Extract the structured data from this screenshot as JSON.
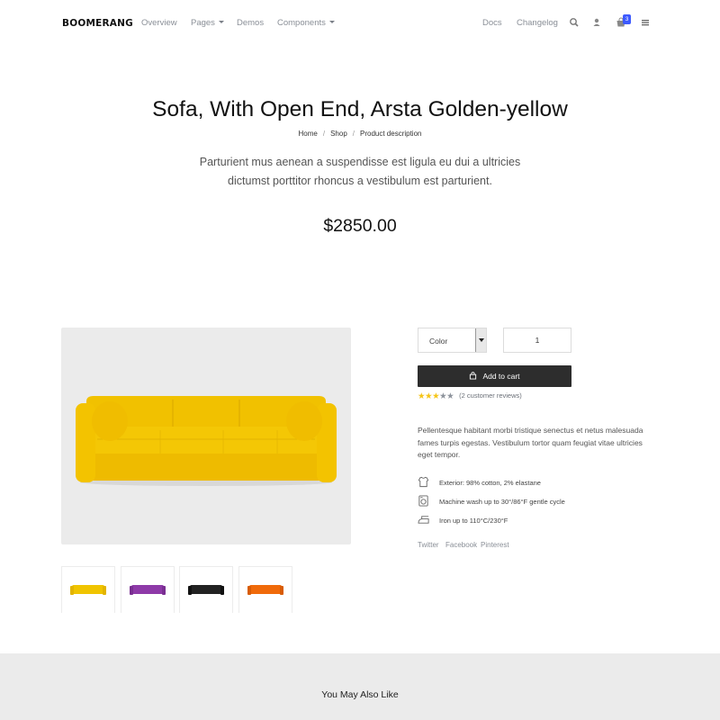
{
  "nav": {
    "brand": "BOOMERANG",
    "items": [
      {
        "label": "Overview"
      },
      {
        "label": "Pages"
      },
      {
        "label": "Demos"
      },
      {
        "label": "Components"
      }
    ],
    "right_items": [
      {
        "label": "Docs"
      },
      {
        "label": "Changelog"
      }
    ],
    "icons": [
      "search-icon",
      "user-icon",
      "cart-icon",
      "menu-icon"
    ],
    "cart_count": "3"
  },
  "hero": {
    "title": "Sofa, With Open End, Arsta Golden-yellow",
    "breadcrumb": [
      "Home",
      "Shop",
      "Product description"
    ],
    "subtitle": "Parturient mus aenean a suspendisse est ligula eu dui a ultricies dictumst porttitor rhoncus a vestibulum est parturient.",
    "price": "$2850.00"
  },
  "gallery": {
    "thumbnails": [
      {
        "color": "#f0c400"
      },
      {
        "color": "#8e3aa8"
      },
      {
        "color": "#222222"
      },
      {
        "color": "#f06a0a"
      }
    ]
  },
  "product": {
    "color_label": "Color",
    "quantity": "1",
    "add_to_cart": "Add to cart",
    "rating": 3,
    "rating_max": 5,
    "reviews": "(2 customer reviews)",
    "description": "Pellentesque habitant morbi tristique senectus et netus malesuada fames turpis egestas. Vestibulum tortor quam feugiat vitae ultricies eget tempor.",
    "features": [
      {
        "icon": "shirt-icon",
        "text": "Exterior: 98% cotton, 2% elastane"
      },
      {
        "icon": "washing-machine-icon",
        "text": "Machine wash up to 30°/86°F gentle cycle"
      },
      {
        "icon": "iron-icon",
        "text": "Iron up to 110°C/230°F"
      }
    ],
    "social": [
      "Twitter",
      "Facebook",
      "Pinterest"
    ]
  },
  "related": {
    "title": "You May Also Like"
  },
  "colors": {
    "accent": "#3d5afe",
    "button": "#2d2d2d",
    "star": "#f5c518",
    "sofa": "#f2c300"
  }
}
